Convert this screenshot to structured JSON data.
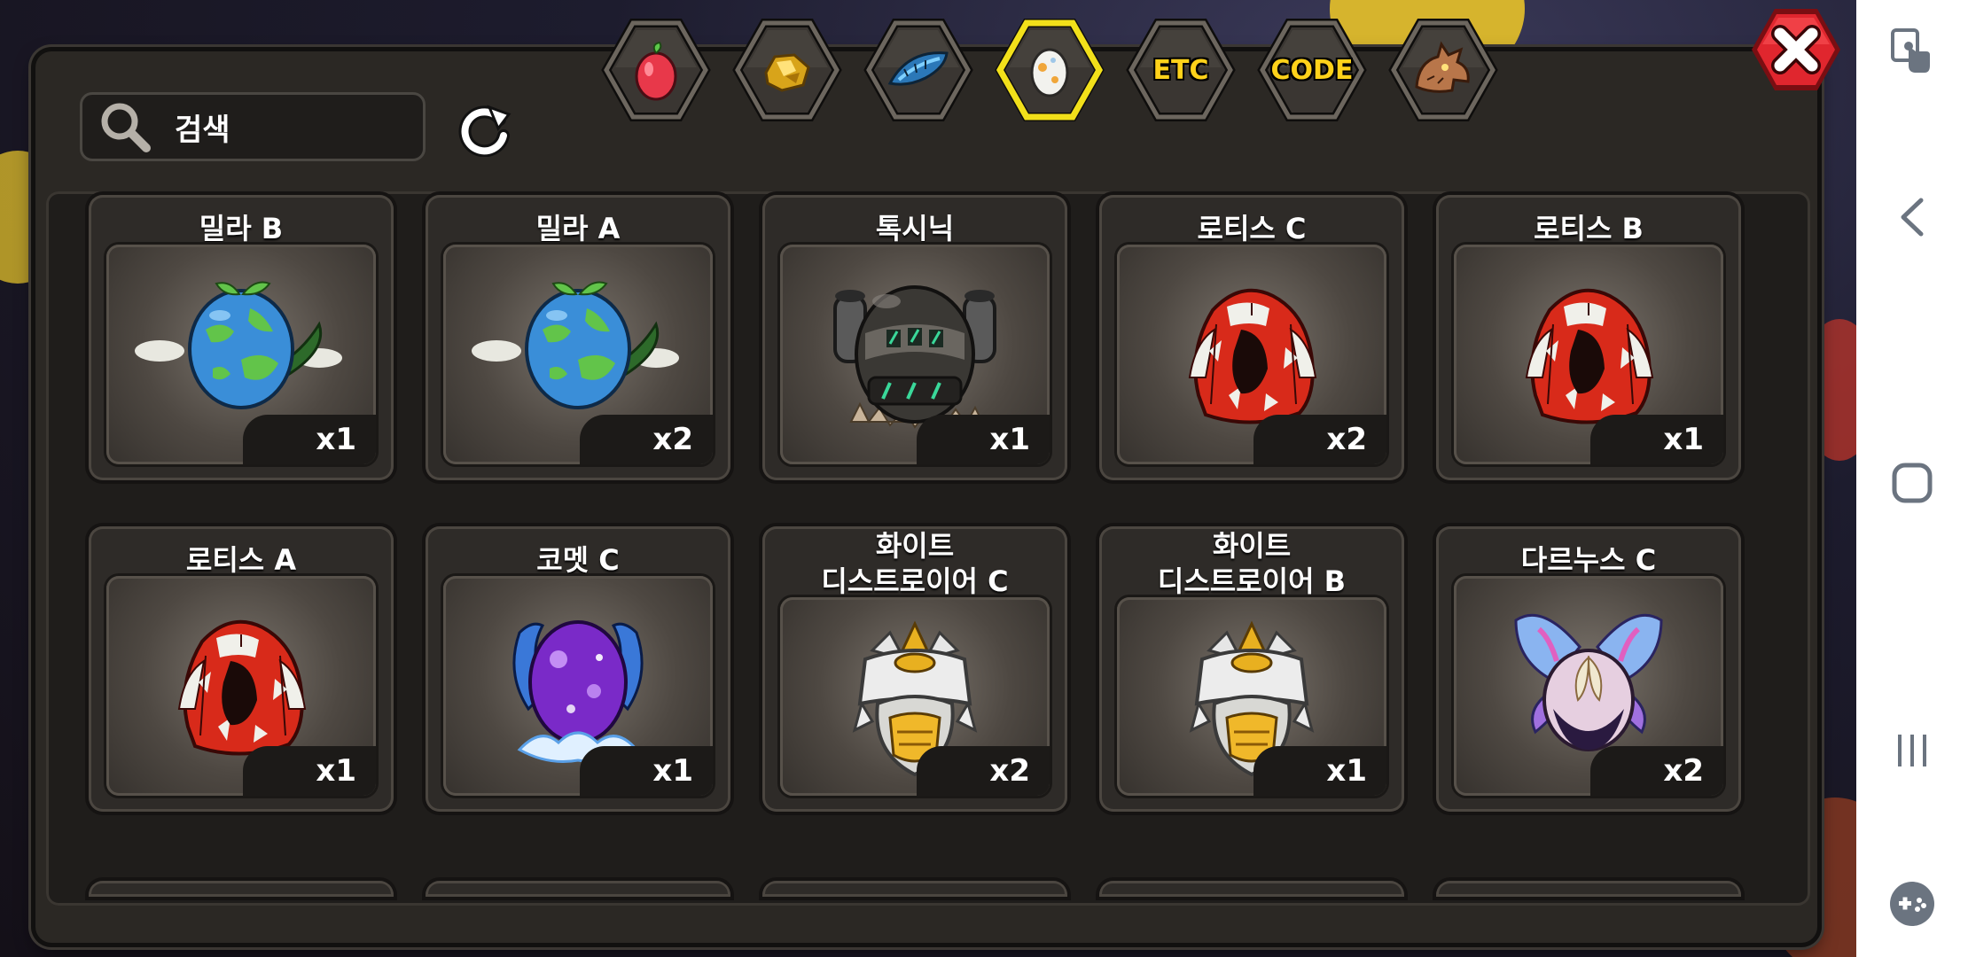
{
  "search": {
    "placeholder": "검색"
  },
  "tabs": [
    {
      "id": "fruit",
      "label": "",
      "icon": "red-fruit-icon",
      "selected": false
    },
    {
      "id": "ore",
      "label": "",
      "icon": "gold-ore-icon",
      "selected": false
    },
    {
      "id": "feather",
      "label": "",
      "icon": "blue-feather-icon",
      "selected": false
    },
    {
      "id": "egg",
      "label": "",
      "icon": "egg-icon",
      "selected": true
    },
    {
      "id": "etc",
      "label": "ETC",
      "icon": "",
      "selected": false
    },
    {
      "id": "code",
      "label": "CODE",
      "icon": "",
      "selected": false
    },
    {
      "id": "dragon",
      "label": "",
      "icon": "dragon-head-icon",
      "selected": false
    }
  ],
  "items": [
    {
      "name": "밀라 B",
      "qty": "x1",
      "icon": "planet-egg-icon"
    },
    {
      "name": "밀라 A",
      "qty": "x2",
      "icon": "planet-egg-icon"
    },
    {
      "name": "톡시닉",
      "qty": "x1",
      "icon": "toxic-armor-egg-icon"
    },
    {
      "name": "로티스 C",
      "qty": "x2",
      "icon": "red-feather-egg-icon"
    },
    {
      "name": "로티스 B",
      "qty": "x1",
      "icon": "red-feather-egg-icon"
    },
    {
      "name": "로티스 A",
      "qty": "x1",
      "icon": "red-feather-egg-icon"
    },
    {
      "name": "코멧 C",
      "qty": "x1",
      "icon": "purple-horned-egg-icon"
    },
    {
      "name": "화이트\n디스트로이어 C",
      "qty": "x2",
      "icon": "white-destroyer-egg-icon"
    },
    {
      "name": "화이트\n디스트로이어 B",
      "qty": "x1",
      "icon": "white-destroyer-egg-icon"
    },
    {
      "name": "다르누스 C",
      "qty": "x2",
      "icon": "butterfly-egg-icon"
    }
  ],
  "colors": {
    "panel": "#2b2824",
    "tab_highlight": "#f2e01a",
    "label_gold": "#ffd21a",
    "close_red": "#e0262e"
  }
}
